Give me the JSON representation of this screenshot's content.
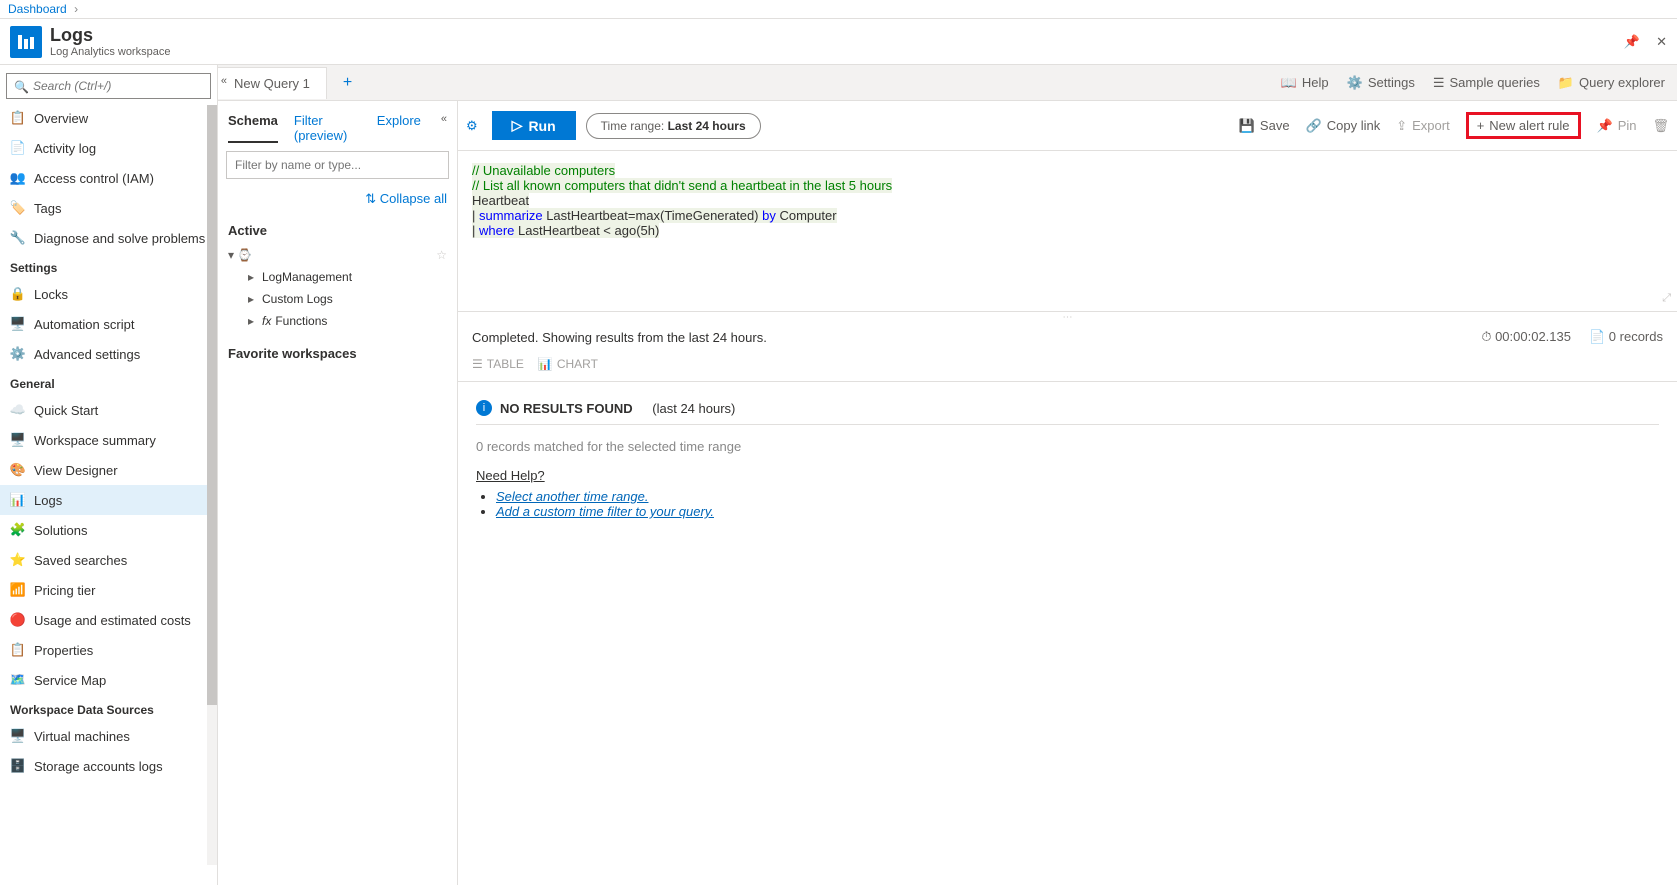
{
  "breadcrumb": {
    "root": "Dashboard"
  },
  "header": {
    "title": "Logs",
    "subtitle": "Log Analytics workspace"
  },
  "sidebar": {
    "search_placeholder": "Search (Ctrl+/)",
    "items_top": [
      {
        "label": "Overview"
      },
      {
        "label": "Activity log"
      },
      {
        "label": "Access control (IAM)"
      },
      {
        "label": "Tags"
      },
      {
        "label": "Diagnose and solve problems"
      }
    ],
    "group_settings": "Settings",
    "items_settings": [
      {
        "label": "Locks"
      },
      {
        "label": "Automation script"
      },
      {
        "label": "Advanced settings"
      }
    ],
    "group_general": "General",
    "items_general": [
      {
        "label": "Quick Start"
      },
      {
        "label": "Workspace summary"
      },
      {
        "label": "View Designer"
      },
      {
        "label": "Logs",
        "active": true
      },
      {
        "label": "Solutions"
      },
      {
        "label": "Saved searches"
      },
      {
        "label": "Pricing tier"
      },
      {
        "label": "Usage and estimated costs"
      },
      {
        "label": "Properties"
      },
      {
        "label": "Service Map"
      }
    ],
    "group_wds": "Workspace Data Sources",
    "items_wds": [
      {
        "label": "Virtual machines"
      },
      {
        "label": "Storage accounts logs"
      }
    ]
  },
  "tabs": {
    "tab1": "New Query 1"
  },
  "topbar": {
    "help": "Help",
    "settings": "Settings",
    "sample": "Sample queries",
    "explorer": "Query explorer"
  },
  "toolbar": {
    "run": "Run",
    "timerange_label": "Time range:",
    "timerange_value": "Last 24 hours",
    "save": "Save",
    "copylink": "Copy link",
    "export": "Export",
    "newalert": "New alert rule",
    "pin": "Pin"
  },
  "schema": {
    "tab_schema": "Schema",
    "tab_filter": "Filter (preview)",
    "tab_explore": "Explore",
    "filter_placeholder": "Filter by name or type...",
    "collapse_all": "Collapse all",
    "active": "Active",
    "tree": [
      {
        "label": "LogManagement"
      },
      {
        "label": "Custom Logs"
      },
      {
        "label": "Functions"
      }
    ],
    "favorite": "Favorite workspaces"
  },
  "editor": {
    "l1": "// Unavailable computers",
    "l2": "// List all known computers that didn't send a heartbeat in the last 5 hours",
    "l3": "Heartbeat",
    "l4_kw": "summarize",
    "l4_rest": " LastHeartbeat=max(TimeGenerated) ",
    "l4_by": "by",
    "l4_end": " Computer",
    "l5_kw": "where",
    "l5_rest": " LastHeartbeat < ago(",
    "l5_num": "5",
    "l5_end": "h)"
  },
  "results": {
    "status": "Completed. Showing results from the last 24 hours.",
    "duration": "00:00:02.135",
    "count": "0 records",
    "view_table": "TABLE",
    "view_chart": "CHART",
    "noresults": "NO RESULTS FOUND",
    "noresults_range": "(last 24 hours)",
    "matched": "0 records matched for the selected time range",
    "need_help": "Need Help?",
    "help1": "Select another time range.",
    "help2": "Add a custom time filter to your query."
  }
}
